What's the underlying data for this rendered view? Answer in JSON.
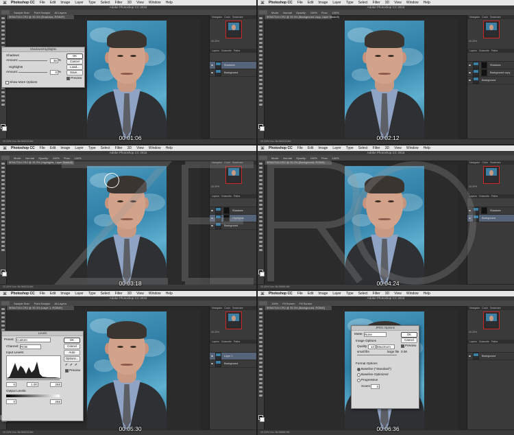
{
  "app_menu": {
    "app_name": "Photoshop CC",
    "items": [
      "File",
      "Edit",
      "Image",
      "Layer",
      "Type",
      "Select",
      "Filter",
      "3D",
      "View",
      "Window",
      "Help"
    ]
  },
  "window_title": "Adobe Photoshop CC 2015",
  "panel_tabs": [
    "Navigator",
    "Color",
    "Swatches"
  ],
  "layers_tabs": [
    "Layers",
    "Channels",
    "Paths"
  ],
  "colors": {
    "menubar": "#e6e6e6",
    "ui_dark": "#282828",
    "sky": "#3b84aa",
    "suit": "#2e3033",
    "selection": "#56647a"
  },
  "panels": [
    {
      "timecode": "00:01:06",
      "doc_tab": "5E5A7244.CR2 @ 33.3% (Shadows, RGB/8*)",
      "options": [
        "Sample Size:",
        "Point Sample",
        "All Layers"
      ],
      "zoom": "33.33%",
      "status": "33.33%   Doc: 66.9M/133.8M",
      "layers": [
        {
          "name": "Shadows",
          "selected": true,
          "mask": false
        },
        {
          "name": "Background",
          "selected": false,
          "mask": false
        }
      ],
      "dialog": {
        "title": "Shadows/Highlights",
        "section1": "Shadows",
        "label1": "Amount:",
        "value1": "35",
        "unit1": "%",
        "section2": "Highlights",
        "label2": "Amount:",
        "value2": "0",
        "unit2": "%",
        "more_options": "Show More Options",
        "buttons": [
          "OK",
          "Cancel",
          "Load...",
          "Save..."
        ],
        "preview": "Preview"
      }
    },
    {
      "timecode": "00:02:12",
      "doc_tab": "5E5A7244.CR2 @ 33.3% (Background copy, Layer Mask/8)",
      "options": [
        "Mode:",
        "Normal",
        "Opacity:",
        "100%",
        "Flow:",
        "100%"
      ],
      "zoom": "33.33%",
      "status": "33.33%   Doc: 66.9M/133.8M",
      "layers": [
        {
          "name": "Shadows",
          "selected": false,
          "mask": true
        },
        {
          "name": "Background copy",
          "selected": false,
          "mask": true
        },
        {
          "name": "Background",
          "selected": false,
          "mask": false
        }
      ]
    },
    {
      "timecode": "00:03:18",
      "doc_tab": "5E5A7244.CR2 @ 33.3% (Highlights, Layer Mask/8)",
      "options": [
        "Mode:",
        "Normal",
        "Opacity:",
        "100%",
        "Flow:",
        "100%"
      ],
      "zoom": "33.33%",
      "status": "33.33%   Doc: 66.9M/133.8M",
      "layers": [
        {
          "name": "Shadows",
          "selected": false,
          "mask": true
        },
        {
          "name": "Highlights",
          "selected": true,
          "mask": true
        },
        {
          "name": "Background",
          "selected": false,
          "mask": false
        }
      ]
    },
    {
      "timecode": "00:04:24",
      "doc_tab": "5E5A7244.CR2 @ 33.3% (Background, RGB/8)",
      "options": [
        "Mode:",
        "Normal",
        "Opacity:",
        "100%",
        "Flow:",
        "100%"
      ],
      "zoom": "33.33%",
      "status": "33.33%   Doc: 66.9M/66.9M",
      "layers": [
        {
          "name": "Shadows",
          "selected": false,
          "mask": true
        },
        {
          "name": "Background",
          "selected": true,
          "mask": false
        }
      ]
    },
    {
      "timecode": "00:05:30",
      "doc_tab": "5E5A7244.CR2 @ 33.3% (Layer 1, RGB/8*)",
      "options": [
        "Sample Size:",
        "Point Sample",
        "All Layers"
      ],
      "zoom": "33.33%",
      "status": "33.33%   Doc: 66.9M/133.8M",
      "layers": [
        {
          "name": "Layer 1",
          "selected": true,
          "mask": false
        },
        {
          "name": "Background",
          "selected": false,
          "mask": false
        }
      ],
      "dialog": {
        "title": "Levels",
        "preset_label": "Preset:",
        "preset_value": "Custom",
        "channel_label": "Channel:",
        "channel_value": "RGB",
        "input_label": "Input Levels:",
        "in_low": "0",
        "in_mid": "1.00",
        "in_high": "255",
        "output_label": "Output Levels:",
        "out_low": "0",
        "out_high": "255",
        "buttons": [
          "OK",
          "Cancel",
          "Auto",
          "Options..."
        ],
        "preview": "Preview"
      }
    },
    {
      "timecode": "00:06:36",
      "doc_tab": "5E5A7244.CR2 @ 33.3% (Background, RGB/8)",
      "options": [
        "100%",
        "Fit Screen",
        "Fill Screen"
      ],
      "zoom": "33.33%",
      "status": "33.33%   Doc: 66.9M/66.9M",
      "layers": [
        {
          "name": "Background",
          "selected": false,
          "mask": false
        }
      ],
      "dialog": {
        "title": "JPEG Options",
        "matte_label": "Matte:",
        "matte_value": "None",
        "image_options": "Image Options",
        "quality_label": "Quality:",
        "quality_value": "12",
        "quality_preset": "Maximum",
        "small_file": "small file",
        "large_file": "large file",
        "format_options": "Format Options",
        "fmt1": "Baseline (\"Standard\")",
        "fmt2": "Baseline Optimized",
        "fmt3": "Progressive",
        "scans_label": "Scans:",
        "scans_value": "3",
        "buttons": [
          "OK",
          "Cancel"
        ],
        "preview": "Preview",
        "size": "0.0K"
      }
    }
  ]
}
